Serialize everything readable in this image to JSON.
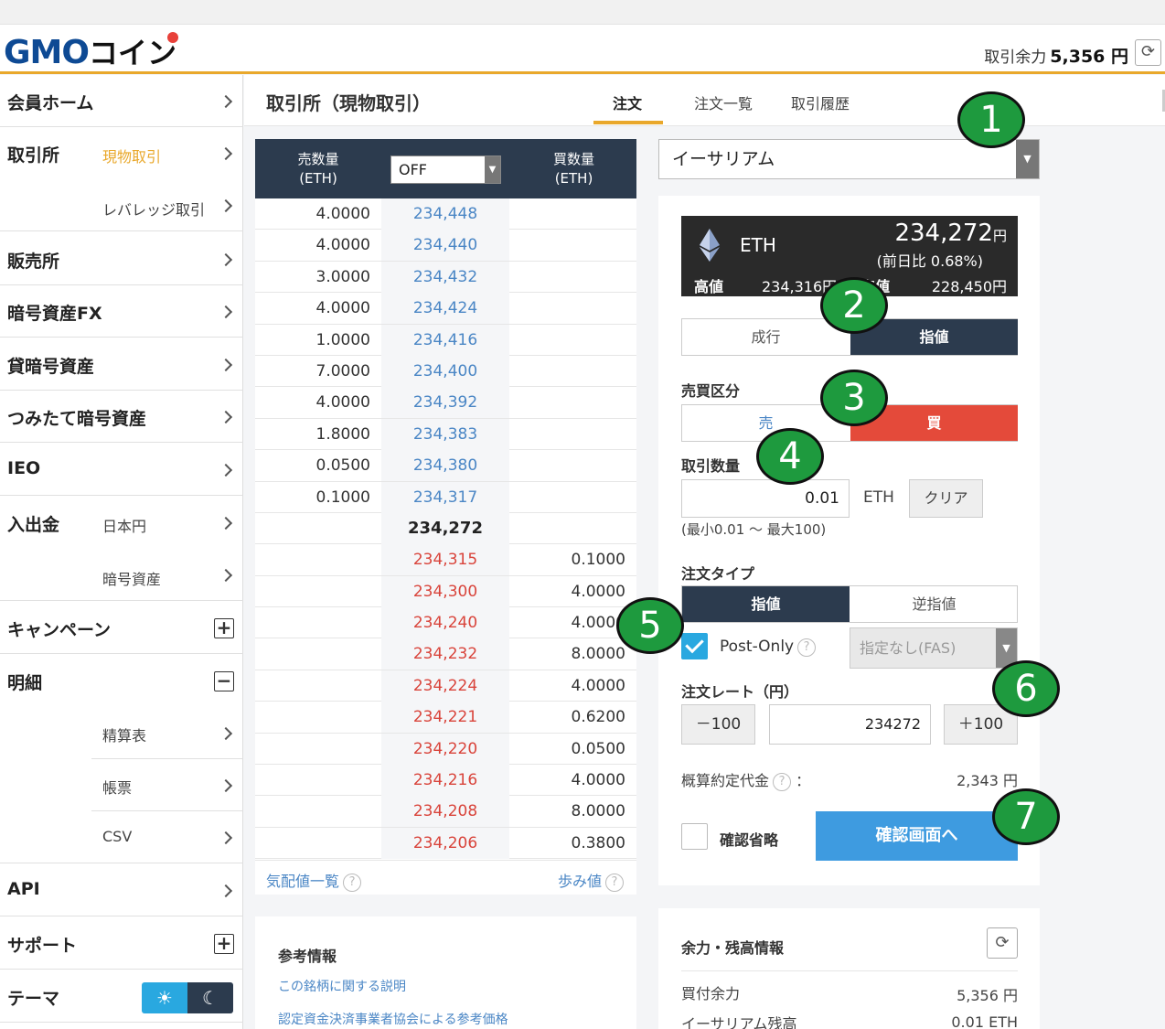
{
  "header": {
    "logo_text": "GMO",
    "logo_suffix": "コイン",
    "balance_label": "取引余力",
    "balance_value": "5,356 円"
  },
  "sidebar": {
    "member_home": "会員ホーム",
    "exchange": "取引所",
    "spot": "現物取引",
    "leverage": "レバレッジ取引",
    "sales": "販売所",
    "fx": "暗号資産FX",
    "lending": "貸暗号資産",
    "tsumitate": "つみたて暗号資産",
    "ieo": "IEO",
    "deposit": "入出金",
    "jpy": "日本円",
    "crypto": "暗号資産",
    "campaign": "キャンペーン",
    "details": "明細",
    "settlement": "精算表",
    "ledger": "帳票",
    "csv": "CSV",
    "api": "API",
    "support": "サポート",
    "theme": "テーマ"
  },
  "main": {
    "title": "取引所（現物取引）",
    "tabs": [
      "注文",
      "注文一覧",
      "取引履歴"
    ]
  },
  "book": {
    "sell_header": "売数量\n(ETH)",
    "buy_header": "買数量\n(ETH)",
    "filter_value": "OFF",
    "asks": [
      {
        "qty": "4.0000",
        "price": "234,448"
      },
      {
        "qty": "4.0000",
        "price": "234,440"
      },
      {
        "qty": "3.0000",
        "price": "234,432"
      },
      {
        "qty": "4.0000",
        "price": "234,424"
      },
      {
        "qty": "1.0000",
        "price": "234,416"
      },
      {
        "qty": "7.0000",
        "price": "234,400"
      },
      {
        "qty": "4.0000",
        "price": "234,392"
      },
      {
        "qty": "1.8000",
        "price": "234,383"
      },
      {
        "qty": "0.0500",
        "price": "234,380"
      },
      {
        "qty": "0.1000",
        "price": "234,317"
      }
    ],
    "mid": "234,272",
    "bids": [
      {
        "price": "234,315",
        "qty": "0.1000"
      },
      {
        "price": "234,300",
        "qty": "4.0000"
      },
      {
        "price": "234,240",
        "qty": "4.0000"
      },
      {
        "price": "234,232",
        "qty": "8.0000"
      },
      {
        "price": "234,224",
        "qty": "4.0000"
      },
      {
        "price": "234,221",
        "qty": "0.6200"
      },
      {
        "price": "234,220",
        "qty": "0.0500"
      },
      {
        "price": "234,216",
        "qty": "4.0000"
      },
      {
        "price": "234,208",
        "qty": "8.0000"
      },
      {
        "price": "234,206",
        "qty": "0.3800"
      }
    ],
    "quotes_link": "気配値一覧",
    "trades_link": "歩み値"
  },
  "reference": {
    "title": "参考情報",
    "link1": "この銘柄に関する説明",
    "link2": "認定資金決済事業者協会による参考価格"
  },
  "order": {
    "currency": "イーサリアム",
    "symbol": "ETH",
    "price": "234,272",
    "price_unit": "円",
    "change": "(前日比 0.68%)",
    "high_label": "高値",
    "high_value": "234,316円",
    "low_label": "安値",
    "low_value": "228,450円",
    "market": "成行",
    "limit": "指値",
    "side_label": "売買区分",
    "sell": "売",
    "buy": "買",
    "qty_label": "取引数量",
    "qty_value": "0.01",
    "qty_unit": "ETH",
    "clear": "クリア",
    "qty_hint": "(最小0.01 〜 最大100)",
    "type_label": "注文タイプ",
    "type_limit": "指値",
    "type_stop": "逆指値",
    "post_only": "Post-Only",
    "tif": "指定なし(FAS)",
    "rate_label": "注文レート（円）",
    "minus": "－100",
    "rate_value": "234272",
    "plus": "＋100",
    "est_label": "概算約定代金",
    "est_colon": "：",
    "est_value": "2,343 円",
    "skip_confirm": "確認省略",
    "confirm": "確認画面へ"
  },
  "balance": {
    "title": "余力・残高情報",
    "buy_power_label": "買付余力",
    "buy_power_value": "5,356 円",
    "eth_label": "イーサリアム残高",
    "eth_value": "0.01 ETH"
  },
  "callouts": [
    "1",
    "2",
    "3",
    "4",
    "5",
    "6",
    "7"
  ]
}
